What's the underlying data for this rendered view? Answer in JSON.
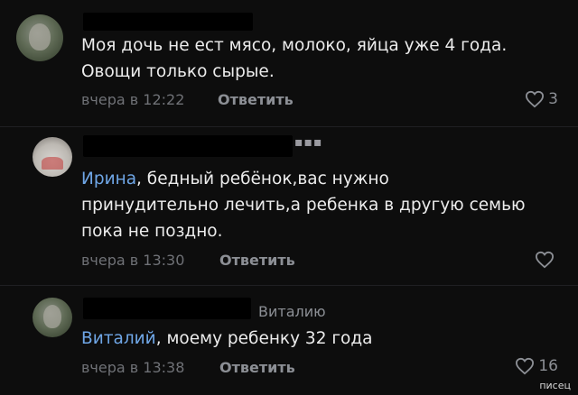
{
  "comments": [
    {
      "line1": "Моя дочь не ест мясо, молоко, яйца уже 4 года.",
      "line2": "Овощи только сырые.",
      "time": "вчера в 12:22",
      "reply": "Ответить",
      "likes": "3"
    },
    {
      "mention": "Ирина",
      "line1_rest": ", бедный ребёнок,вас нужно",
      "line2": "принудительно лечить,а ребенка в другую семью",
      "line3": "пока не поздно.",
      "time": "вчера в 13:30",
      "reply": "Ответить",
      "likes": ""
    },
    {
      "reply_to": "Виталию",
      "mention": "Виталий",
      "line1_rest": ", моему ребенку 32 года",
      "time": "вчера в 13:38",
      "reply": "Ответить",
      "likes": "16"
    }
  ],
  "watermark": "писец",
  "colors": {
    "background": "#0d0d0d",
    "link": "#6fa6e6",
    "muted": "#8c8f95"
  },
  "icons": {
    "like": "heart-icon"
  }
}
